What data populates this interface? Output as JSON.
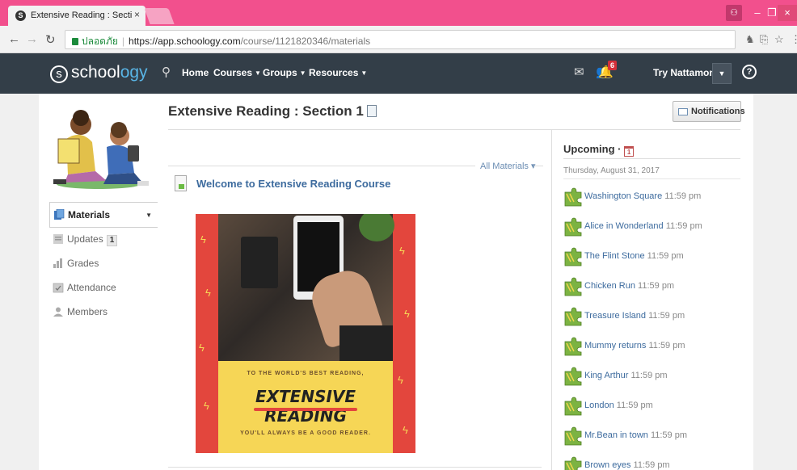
{
  "browser": {
    "tab_title": "Extensive Reading : Secti",
    "tab_close": "×",
    "secure_label": "ปลอดภัย",
    "url_host": "https://app.schoology.com",
    "url_path": "/course/1121820346/materials",
    "profile_glyph": "⚇",
    "minimize": "–",
    "maximize": "❐",
    "close": "×"
  },
  "header": {
    "logo_text": "school",
    "logo_suffix": "ogy",
    "logo_mark": "s",
    "nav": [
      {
        "label": "Home"
      },
      {
        "label": "Courses"
      },
      {
        "label": "Groups"
      },
      {
        "label": "Resources"
      }
    ],
    "notification_count": "6",
    "user_name": "Try Nattamon",
    "help": "?"
  },
  "course": {
    "title": "Extensive Reading : Section 1",
    "notifications_label": "Notifications",
    "filter_label": "All Materials",
    "filter_caret": "▾",
    "material_title": "Welcome to Extensive Reading Course",
    "poster": {
      "tagline_top": "TO THE WORLD'S BEST READING,",
      "headline": "EXTENSIVE READING",
      "tagline_bottom": "YOU'LL ALWAYS BE A GOOD READER."
    }
  },
  "sidebar": {
    "items": [
      {
        "label": "Materials"
      },
      {
        "label": "Updates",
        "count": "1"
      },
      {
        "label": "Grades"
      },
      {
        "label": "Attendance"
      },
      {
        "label": "Members"
      }
    ]
  },
  "upcoming": {
    "title": "Upcoming ·",
    "cal_day": "1",
    "date": "Thursday, August 31, 2017",
    "events": [
      {
        "name": "Washington Square",
        "time": "11:59 pm"
      },
      {
        "name": "Alice in Wonderland",
        "time": "11:59 pm"
      },
      {
        "name": "The Flint Stone",
        "time": "11:59 pm"
      },
      {
        "name": "Chicken Run",
        "time": "11:59 pm"
      },
      {
        "name": "Treasure Island",
        "time": "11:59 pm"
      },
      {
        "name": "Mummy returns",
        "time": "11:59 pm"
      },
      {
        "name": "King Arthur",
        "time": "11:59 pm"
      },
      {
        "name": "London",
        "time": "11:59 pm"
      },
      {
        "name": "Mr.Bean in town",
        "time": "11:59 pm"
      },
      {
        "name": "Brown eyes",
        "time": "11:59 pm"
      }
    ]
  }
}
